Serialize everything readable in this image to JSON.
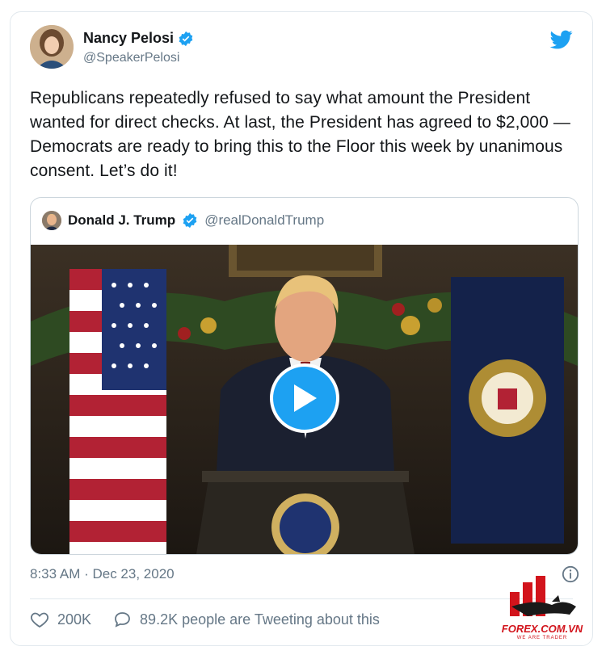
{
  "tweet": {
    "author_name": "Nancy Pelosi",
    "author_handle": "@SpeakerPelosi",
    "text": "Republicans repeatedly refused to say what amount the President wanted for direct checks. At last, the President has agreed to $2,000 — Democrats are ready to bring this to the Floor this week by unanimous consent. Let’s do it!",
    "timestamp": "8:33 AM · Dec 23, 2020",
    "likes": "200K",
    "replies_text": "89.2K people are Tweeting about this"
  },
  "quoted": {
    "author_name": "Donald J. Trump",
    "author_handle": "@realDonaldTrump",
    "media": "video"
  },
  "watermark": {
    "brand": "FOREX.COM.VN",
    "slogan": "WE ARE TRADER"
  },
  "colors": {
    "accent": "#1da1f2",
    "text": "#14171a",
    "secondary": "#657786",
    "border": "#e1e8ed",
    "watermark": "#d2141c"
  },
  "icons": [
    "verified-icon",
    "twitter-bird-icon",
    "play-icon",
    "info-icon",
    "heart-icon",
    "comment-icon"
  ]
}
